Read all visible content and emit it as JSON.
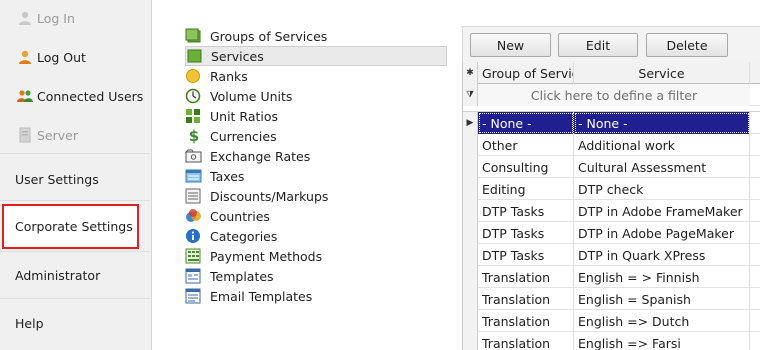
{
  "nav": {
    "login": "Log In",
    "logout": "Log Out",
    "connected_users": "Connected Users",
    "server": "Server",
    "user_settings": "User Settings",
    "corporate_settings": "Corporate Settings",
    "administrator": "Administrator",
    "help": "Help"
  },
  "tree": {
    "items": [
      {
        "label": "Groups of Services",
        "icon": "groups-of-services-icon"
      },
      {
        "label": "Services",
        "icon": "services-icon"
      },
      {
        "label": "Ranks",
        "icon": "ranks-icon"
      },
      {
        "label": "Volume Units",
        "icon": "volume-units-icon"
      },
      {
        "label": "Unit Ratios",
        "icon": "unit-ratios-icon"
      },
      {
        "label": "Currencies",
        "icon": "currencies-icon"
      },
      {
        "label": "Exchange Rates",
        "icon": "exchange-rates-icon"
      },
      {
        "label": "Taxes",
        "icon": "taxes-icon"
      },
      {
        "label": "Discounts/Markups",
        "icon": "discounts-markups-icon"
      },
      {
        "label": "Countries",
        "icon": "countries-icon"
      },
      {
        "label": "Categories",
        "icon": "categories-icon"
      },
      {
        "label": "Payment Methods",
        "icon": "payment-methods-icon"
      },
      {
        "label": "Templates",
        "icon": "templates-icon"
      },
      {
        "label": "Email Templates",
        "icon": "email-templates-icon"
      }
    ]
  },
  "toolbar": {
    "new_label": "New",
    "edit_label": "Edit",
    "delete_label": "Delete"
  },
  "grid": {
    "new_row_marker": "✱",
    "filter_marker": "⧩",
    "current_marker": "▶",
    "col_group": "Group of Servic",
    "col_service": "Service",
    "filter_text": "Click here to define a filter",
    "rows": [
      {
        "group": "- None -",
        "service": "- None -"
      },
      {
        "group": "Other",
        "service": "Additional work"
      },
      {
        "group": "Consulting",
        "service": "Cultural Assessment"
      },
      {
        "group": "Editing",
        "service": "DTP check"
      },
      {
        "group": "DTP Tasks",
        "service": "DTP in Adobe FrameMaker"
      },
      {
        "group": "DTP Tasks",
        "service": "DTP in Adobe PageMaker"
      },
      {
        "group": "DTP Tasks",
        "service": "DTP in Quark XPress"
      },
      {
        "group": "Translation",
        "service": "English = > Finnish"
      },
      {
        "group": "Translation",
        "service": "English = Spanish"
      },
      {
        "group": "Translation",
        "service": "English => Dutch"
      },
      {
        "group": "Translation",
        "service": "English => Farsi"
      }
    ]
  },
  "colors": {
    "selection_highlight": "#1f1f8f",
    "nav_highlight_border": "#e02020"
  }
}
